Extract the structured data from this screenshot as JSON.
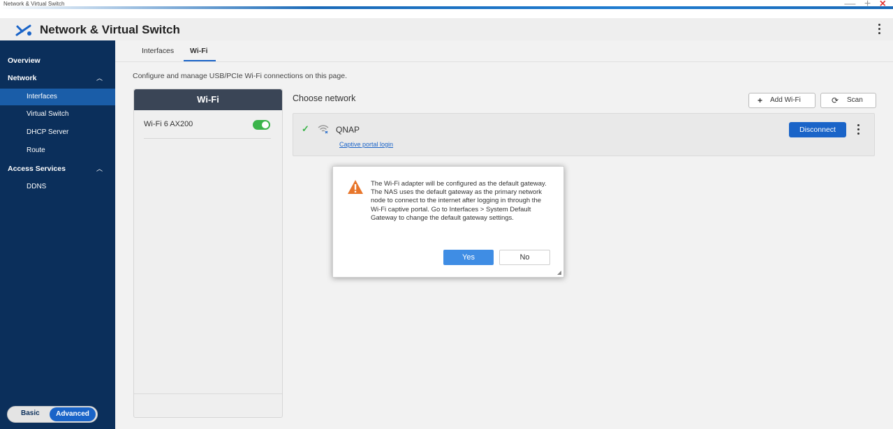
{
  "window": {
    "title": "Network & Virtual Switch",
    "controls": {
      "minimize": "—",
      "maximize": "+",
      "close": "×"
    }
  },
  "app": {
    "title": "Network & Virtual Switch"
  },
  "sidebar": {
    "items": [
      {
        "label": "Overview",
        "type": "header"
      },
      {
        "label": "Network",
        "type": "header",
        "expanded": true
      },
      {
        "label": "Interfaces",
        "type": "sub",
        "active": true
      },
      {
        "label": "Virtual Switch",
        "type": "sub"
      },
      {
        "label": "DHCP Server",
        "type": "sub"
      },
      {
        "label": "Route",
        "type": "sub"
      },
      {
        "label": "Access Services",
        "type": "header",
        "expanded": true
      },
      {
        "label": "DDNS",
        "type": "sub"
      }
    ],
    "mode": {
      "basic": "Basic",
      "advanced": "Advanced",
      "selected": "Advanced"
    }
  },
  "tabs": [
    {
      "label": "Interfaces"
    },
    {
      "label": "Wi-Fi",
      "active": true
    }
  ],
  "description": "Configure and manage USB/PCIe Wi-Fi connections on this page.",
  "wifi_panel": {
    "header": "Wi-Fi",
    "adapters": [
      {
        "name": "Wi-Fi 6 AX200",
        "enabled": true
      }
    ]
  },
  "choose_network": {
    "title": "Choose network",
    "add_wifi": "Add Wi-Fi",
    "scan": "Scan",
    "networks": [
      {
        "ssid": "QNAP",
        "connected": true,
        "portal_link": "Captive portal login",
        "action": "Disconnect"
      }
    ]
  },
  "dialog": {
    "message": "The Wi-Fi adapter will be configured as the default gateway. The NAS uses the default gateway as the primary network node to connect to the internet after logging in through the Wi-Fi captive portal. Go to Interfaces > System Default Gateway to change the default gateway settings.",
    "yes": "Yes",
    "no": "No"
  },
  "colors": {
    "sidebar_bg": "#0b2f5b",
    "sidebar_active": "#1a5da8",
    "accent": "#1a64c8",
    "toggle_on": "#3bb44a",
    "warning": "#e8762b"
  },
  "icons": {
    "app": "network-switch-icon",
    "add": "plus-icon",
    "scan": "refresh-icon",
    "connected": "check-icon",
    "signal": "wifi-secured-icon",
    "warning": "warning-icon"
  }
}
